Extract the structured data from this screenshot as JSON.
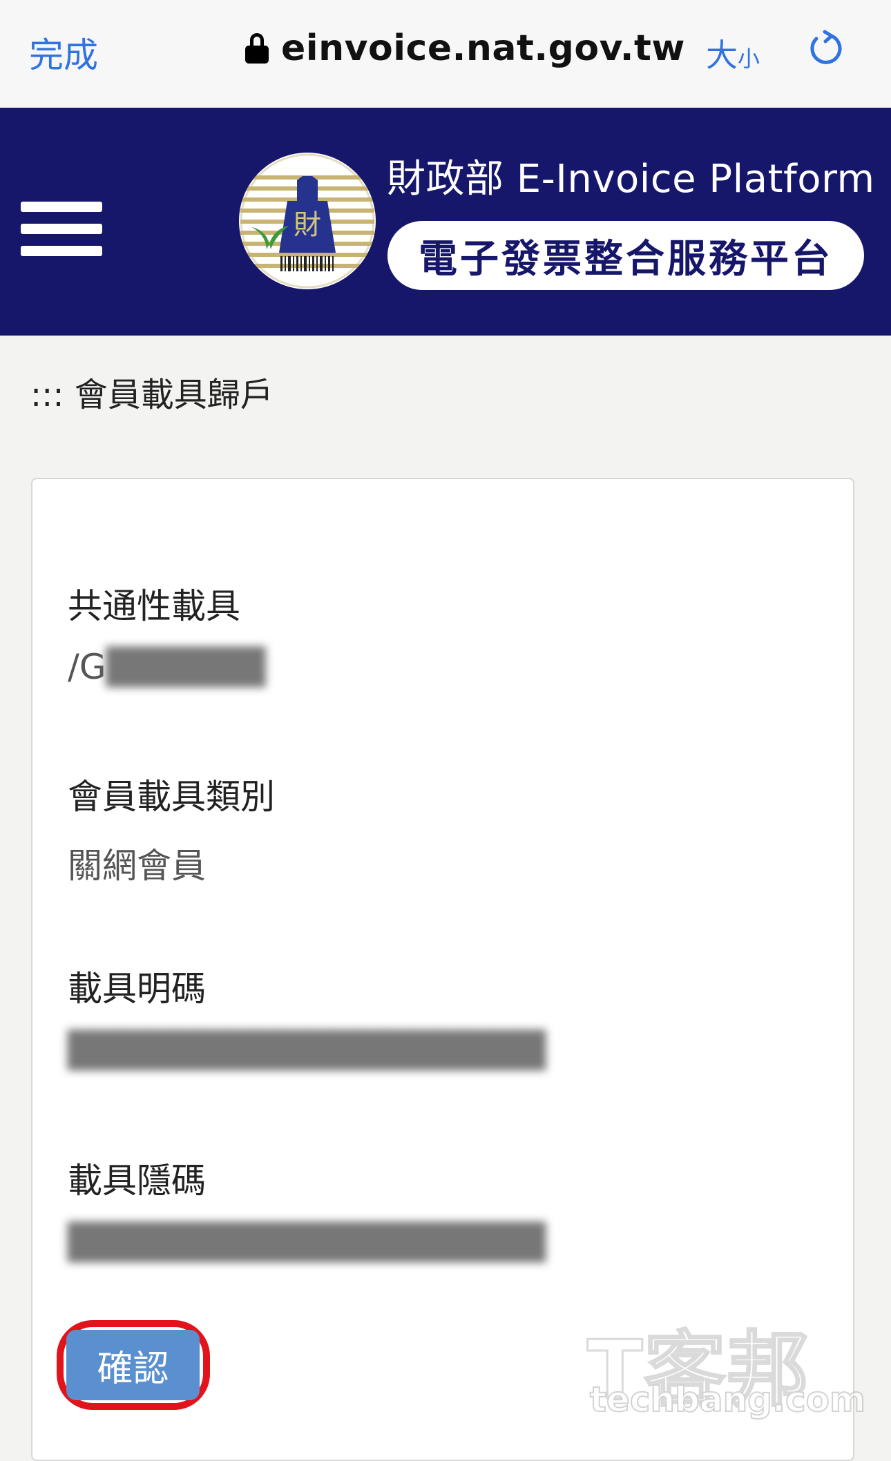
{
  "browser": {
    "done_label": "完成",
    "url": "einvoice.nat.gov.tw",
    "text_size_big": "大",
    "text_size_small": "小",
    "icons": [
      "lock-icon",
      "reload-icon"
    ]
  },
  "header": {
    "title": "財政部 E-Invoice Platform",
    "subtitle": "電子發票整合服務平台",
    "background_color": "#16166b",
    "icons": [
      "menu-icon",
      "ministry-logo"
    ]
  },
  "breadcrumb": "::: 會員載具歸戶",
  "fields": [
    {
      "label": "共通性載具",
      "value": "/G"
    },
    {
      "label": "會員載具類別",
      "value": "關網會員"
    },
    {
      "label": "載具明碼",
      "value": ""
    },
    {
      "label": "載具隱碼",
      "value": ""
    }
  ],
  "confirm_label": "確認",
  "watermark": {
    "big": "T客邦",
    "small": "techbang.com"
  },
  "colors": {
    "accent": "#2f73e0",
    "button": "#5a8fd0",
    "highlight": "#e1141b"
  }
}
